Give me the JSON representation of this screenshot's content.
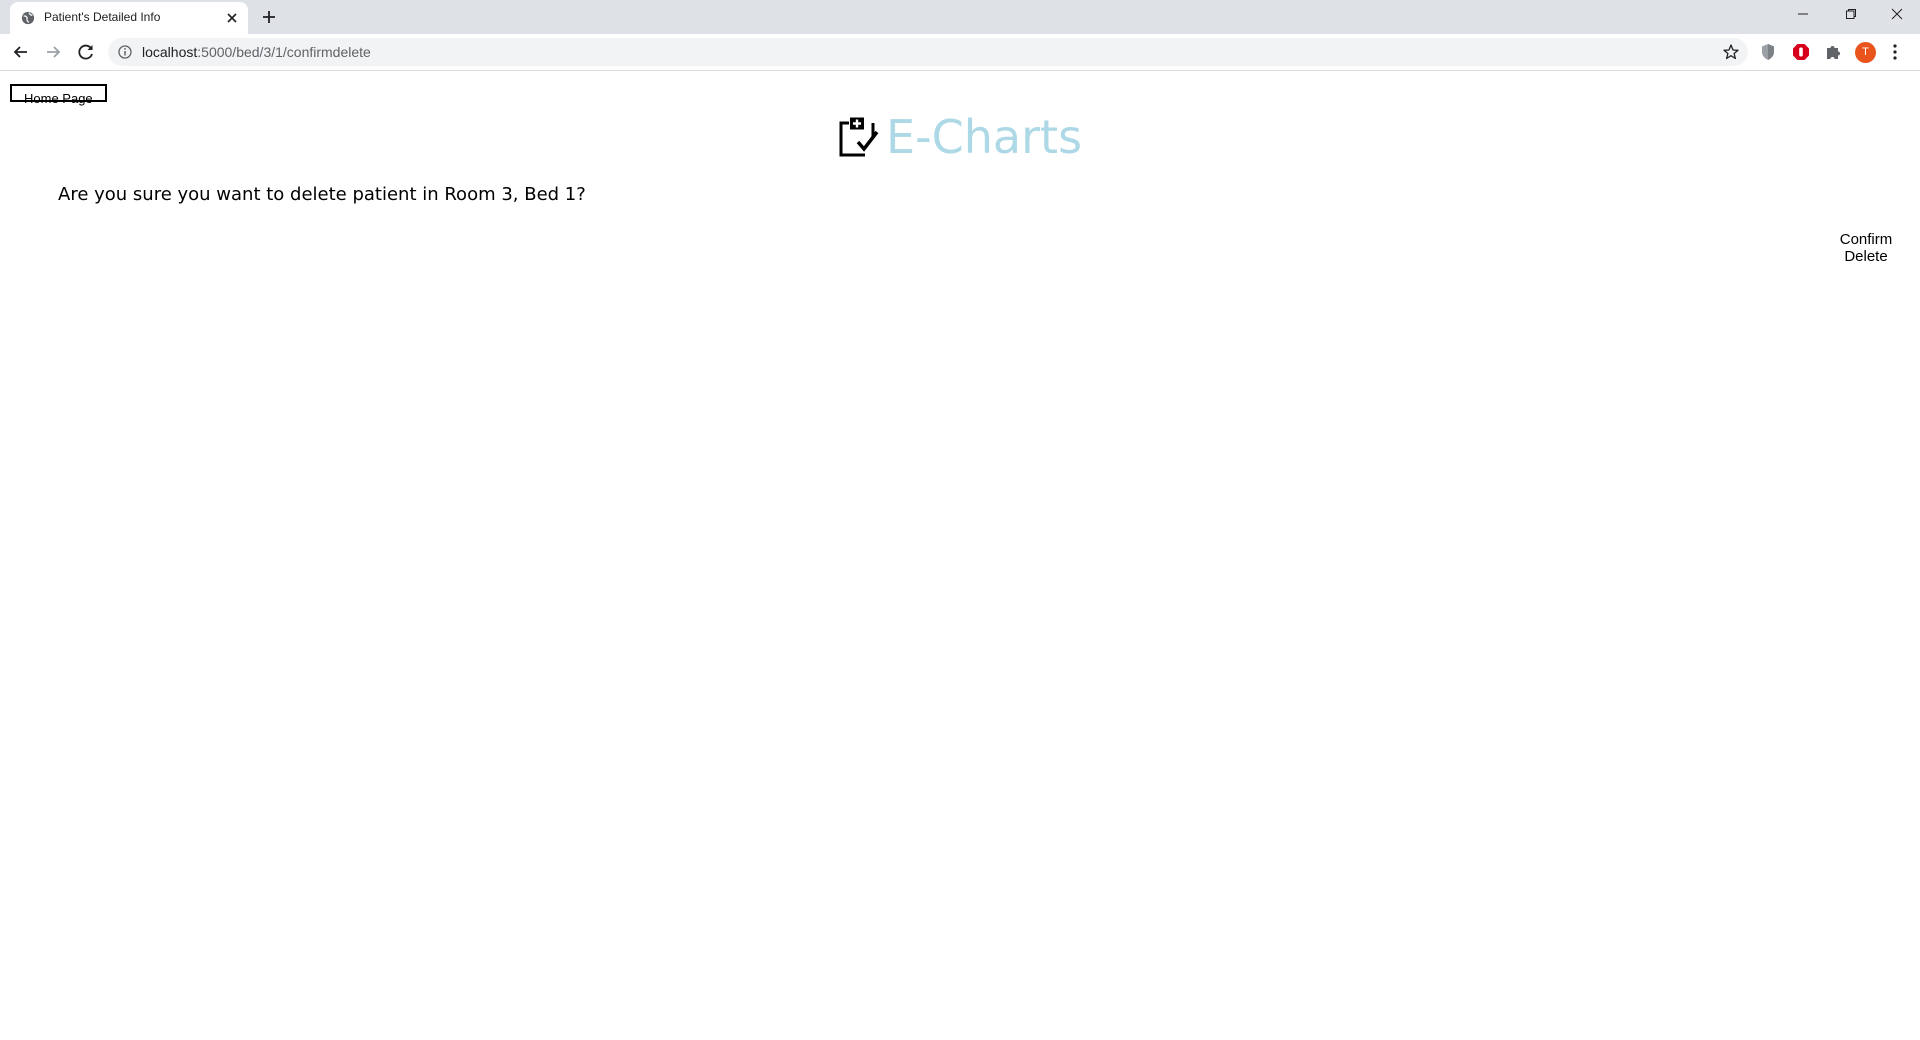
{
  "browser": {
    "tab_title": "Patient's Detailed Info",
    "url_host": "localhost",
    "url_path": ":5000/bed/3/1/confirmdelete",
    "profile_initial": "T",
    "icons": {
      "favicon": "globe-icon",
      "close": "close-icon",
      "new_tab": "plus-icon",
      "back": "back-arrow-icon",
      "forward": "forward-arrow-icon",
      "reload": "reload-icon",
      "site_info": "info-icon",
      "bookmark": "star-icon",
      "extensions": [
        "shield-extension-icon",
        "adblock-extension-icon",
        "puzzle-extensions-icon"
      ],
      "menu": "kebab-menu-icon"
    },
    "colors": {
      "tabstrip": "#dee1e6",
      "omnibox": "#f1f3f4",
      "avatar": "#e8541c"
    }
  },
  "page": {
    "home_button_label": "Home Page",
    "brand_title": "E-Charts",
    "brand_icon": "clipboard-check-icon",
    "brand_color": "#add8e6",
    "prompt_text": "Are you sure you want to delete patient in Room 3, Bed 1?",
    "confirm_button_label": "Confirm Delete"
  }
}
